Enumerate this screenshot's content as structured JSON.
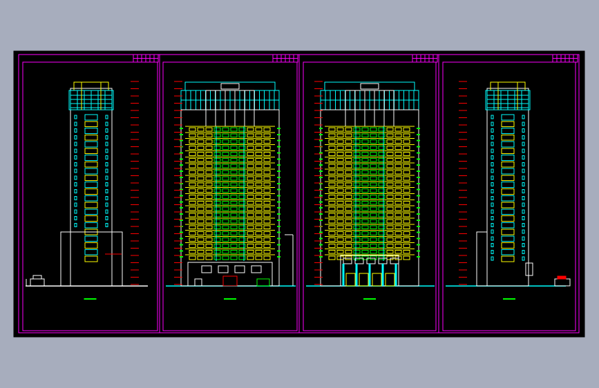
{
  "window": {
    "background": "#a7adbd",
    "canvas_background": "#000000"
  },
  "colors": {
    "frame": "#ff00ff",
    "outline": "#ffffff",
    "window_yellow": "#ffff00",
    "glass_cyan": "#00ffff",
    "balcony_green": "#00ff00",
    "dim_red": "#ff0000",
    "ground": "#00ffff"
  },
  "sheets": [
    {
      "id": "east",
      "view": "side-elevation",
      "mirrored": false,
      "podium": "left-block"
    },
    {
      "id": "south",
      "view": "front-elevation",
      "mirrored": false,
      "podium": "shops"
    },
    {
      "id": "north",
      "view": "front-elevation",
      "mirrored": false,
      "podium": "lobby"
    },
    {
      "id": "west",
      "view": "side-elevation",
      "mirrored": true,
      "podium": "small"
    }
  ],
  "drawing": {
    "floors": 22,
    "front_columns": 10
  }
}
